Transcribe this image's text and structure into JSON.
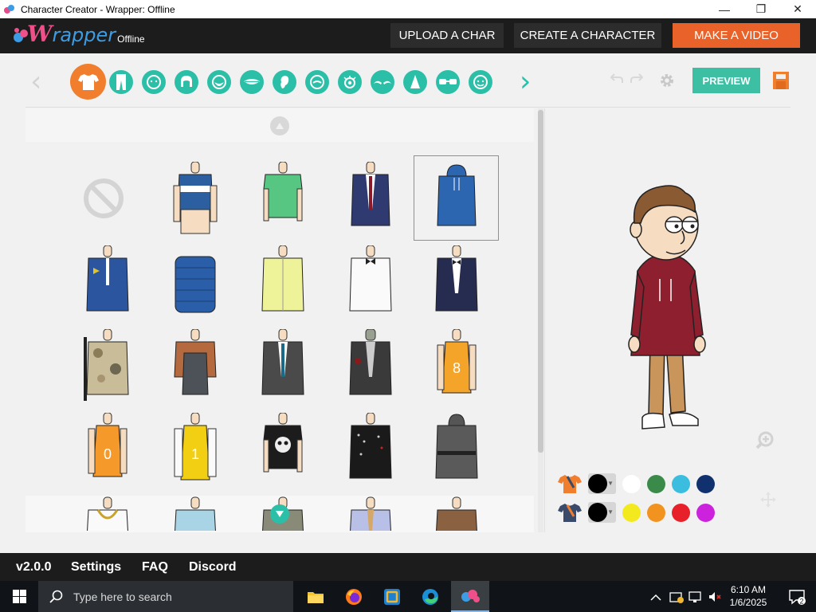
{
  "window": {
    "title": "Character Creator - Wrapper: Offline",
    "minimize": "—",
    "restore": "❐",
    "close": "✕"
  },
  "header": {
    "logo_w": "W",
    "logo_rapper": "rapper",
    "logo_offline": "Offline",
    "upload_label": "UPLOAD A CHAR",
    "create_label": "CREATE A CHARACTER",
    "make_video_label": "MAKE A VIDEO",
    "make_video_color": "#e8622a"
  },
  "toolbar": {
    "categories": [
      "shirt-icon",
      "pants-icon",
      "face-shape-icon",
      "hair-icon",
      "beard-icon",
      "mouth-icon",
      "ear-icon",
      "nose-icon",
      "eyes-icon",
      "eyebrows-icon",
      "hat-icon",
      "glasses-icon",
      "accessory-icon"
    ],
    "active_category": "shirt-icon",
    "preview_label": "PREVIEW",
    "accent_color": "#2bbfa8",
    "active_color": "#f07e2d"
  },
  "grid": {
    "items": [
      "none-icon",
      "striped-polo",
      "green-tshirt",
      "navy-blazer-tie",
      "blue-hoodie",
      "police-uniform",
      "puffer-jacket",
      "yellow-shirt",
      "white-shirt-bowtie",
      "tuxedo",
      "camo-jacket-rifle",
      "brown-overalls",
      "grey-suit",
      "zombie-suit",
      "orange-jersey-8",
      "orange-jersey-0",
      "yellow-jersey-1",
      "skull-tshirt",
      "studded-leather-jacket",
      "grey-robe"
    ],
    "selected_index": 4
  },
  "colors": {
    "row1_icon": "shirt-color-icon",
    "row1": [
      "#000000",
      "#ffffff",
      "#3a8a4a",
      "#3bbde0",
      "#10306e"
    ],
    "row2_icon": "shirt-accent-color-icon",
    "row2": [
      "#000000",
      "#f2ea1f",
      "#f3931f",
      "#e8202a",
      "#cc22dd"
    ]
  },
  "footer": {
    "version": "v2.0.0",
    "settings": "Settings",
    "faq": "FAQ",
    "discord": "Discord"
  },
  "taskbar": {
    "search_placeholder": "Type here to search",
    "time": "6:10 AM",
    "date": "1/6/2025",
    "notification_count": "2"
  }
}
